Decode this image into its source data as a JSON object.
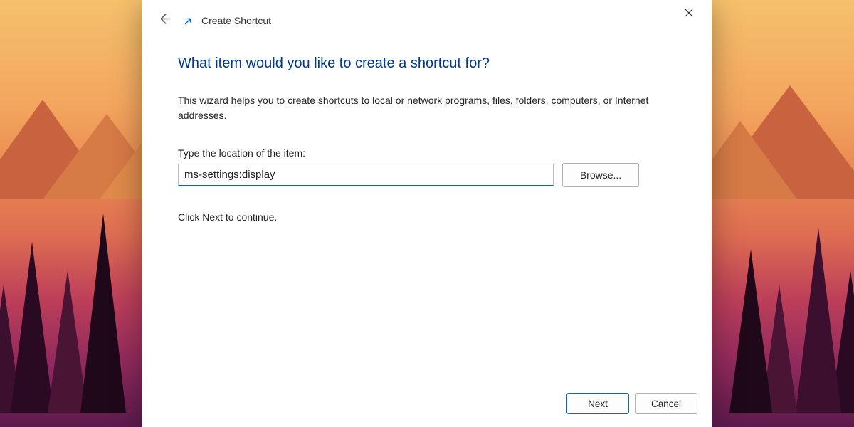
{
  "header": {
    "title": "Create Shortcut"
  },
  "main": {
    "heading": "What item would you like to create a shortcut for?",
    "description": "This wizard helps you to create shortcuts to local or network programs, files, folders, computers, or Internet addresses.",
    "location_label": "Type the location of the item:",
    "location_value": "ms-settings:display",
    "browse_label": "Browse...",
    "continue_text": "Click Next to continue."
  },
  "footer": {
    "next_label": "Next",
    "cancel_label": "Cancel"
  }
}
